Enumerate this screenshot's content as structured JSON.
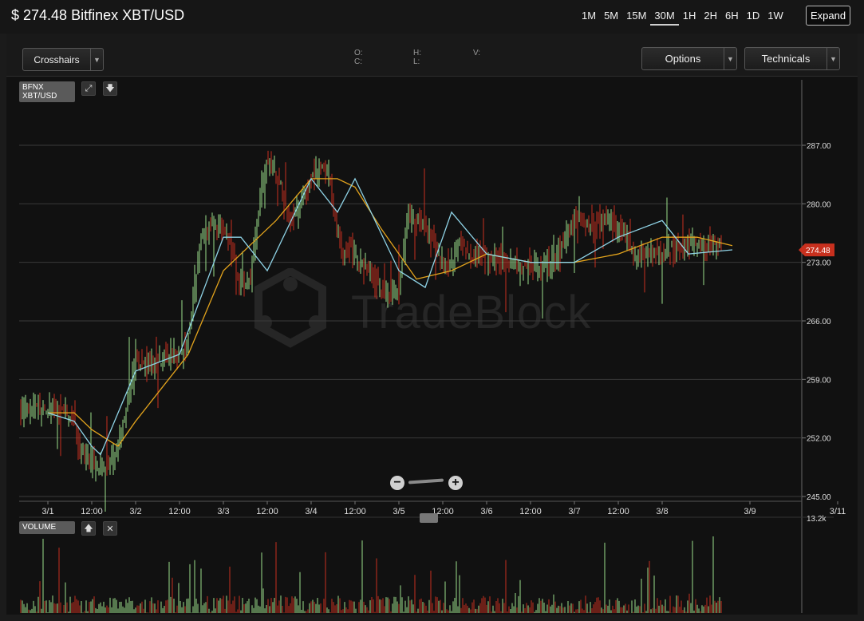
{
  "header": {
    "title": "$ 274.48 Bitfinex XBT/USD",
    "intervals": [
      "1M",
      "5M",
      "15M",
      "30M",
      "1H",
      "2H",
      "6H",
      "1D",
      "1W"
    ],
    "active_interval": "30M",
    "expand_label": "Expand"
  },
  "toolbar": {
    "crosshairs_label": "Crosshairs",
    "options_label": "Options",
    "technicals_label": "Technicals",
    "ohlc": {
      "o": "O:",
      "c": "C:",
      "h": "H:",
      "l": "L:",
      "v": "V:"
    }
  },
  "legend": {
    "symbol_line1": "BFNX",
    "symbol_line2": "XBT/USD",
    "volume_label": "VOLUME"
  },
  "watermark": "TradeBlock",
  "colors": {
    "up": "#9be08a",
    "down": "#c8301e",
    "ma_fast": "#8fd3e6",
    "ma_slow": "#e2a31c",
    "price_flag": "#c8301e"
  },
  "chart_data": {
    "type": "candlestick",
    "price_axis": {
      "ticks": [
        "287.00",
        "280.00",
        "273.00",
        "266.00",
        "259.00",
        "252.00",
        "245.00"
      ],
      "range": [
        245,
        290
      ]
    },
    "current_price": "274.48",
    "x_tick_labels": [
      "3/1",
      "12:00",
      "3/2",
      "12:00",
      "3/3",
      "12:00",
      "3/4",
      "12:00",
      "3/5",
      "12:00",
      "3/6",
      "12:00",
      "3/7",
      "12:00",
      "3/8",
      "3/9",
      "3/11"
    ],
    "x_tick_values": [
      0,
      0.5,
      1,
      1.5,
      2,
      2.5,
      3,
      3.5,
      4,
      4.5,
      5,
      5.5,
      6,
      6.5,
      7,
      8,
      9
    ],
    "volume_axis_max_label": "13.2k",
    "series": [
      {
        "name": "close",
        "x": [
          -0.35,
          0,
          0.2,
          0.3,
          0.35,
          0.5,
          0.6,
          0.75,
          0.8,
          1,
          1.2,
          1.3,
          1.5,
          1.6,
          1.75,
          1.8,
          1.9,
          2,
          2.1,
          2.2,
          2.3,
          2.4,
          2.45,
          2.5,
          2.6,
          2.7,
          2.8,
          2.9,
          3,
          3.1,
          3.2,
          3.25,
          3.35,
          3.45,
          3.55,
          3.6,
          3.75,
          3.9,
          4,
          4.1,
          4.3,
          4.5,
          4.6,
          4.7,
          4.8,
          4.9,
          5,
          5.2,
          5.3,
          5.4,
          5.6,
          5.8,
          6,
          6.2,
          6.4,
          6.6,
          6.7,
          6.8,
          6.9,
          7,
          7.1,
          7.2,
          7.3,
          7.4,
          7.5,
          7.6,
          7.7,
          7.8
        ],
        "y": [
          255.5,
          255.3,
          255,
          254.5,
          251,
          249,
          249,
          249.5,
          251,
          261,
          261,
          261.5,
          262,
          264,
          276,
          276.5,
          277.5,
          277,
          274,
          270.5,
          271,
          279,
          283,
          285,
          284,
          280,
          278,
          280.5,
          283,
          284.5,
          283.5,
          279,
          274,
          274.5,
          272.5,
          272.5,
          270.5,
          269,
          270,
          279,
          277.5,
          272.5,
          273,
          276,
          273.5,
          274,
          273.5,
          273,
          273,
          272.5,
          272.5,
          273.5,
          278.5,
          277.5,
          278,
          276.5,
          273,
          274,
          274,
          274.5,
          274.5,
          275,
          275,
          275,
          275,
          275,
          275,
          275
        ]
      },
      {
        "name": "ma_fast",
        "x": [
          0,
          0.3,
          0.5,
          0.6,
          1,
          1.5,
          2,
          2.2,
          2.5,
          3,
          3.3,
          3.5,
          4,
          4.3,
          4.6,
          5,
          5.5,
          6,
          6.5,
          7,
          7.3,
          7.8
        ],
        "y": [
          255,
          254,
          251,
          250,
          260,
          262,
          276,
          276,
          272,
          283,
          279,
          283,
          272,
          270,
          279,
          274,
          273,
          273,
          276,
          278,
          274,
          274.5
        ]
      },
      {
        "name": "ma_slow",
        "x": [
          0,
          0.3,
          0.5,
          0.8,
          1,
          1.3,
          1.6,
          2,
          2.3,
          2.6,
          3,
          3.3,
          3.5,
          3.8,
          4.2,
          4.6,
          5,
          5.5,
          6,
          6.5,
          7,
          7.4,
          7.8
        ],
        "y": [
          255,
          255,
          253,
          251,
          254,
          258,
          262,
          272,
          275,
          278,
          283,
          283,
          282,
          277,
          271,
          272,
          274,
          273,
          273,
          274,
          276,
          276,
          275
        ]
      }
    ]
  }
}
